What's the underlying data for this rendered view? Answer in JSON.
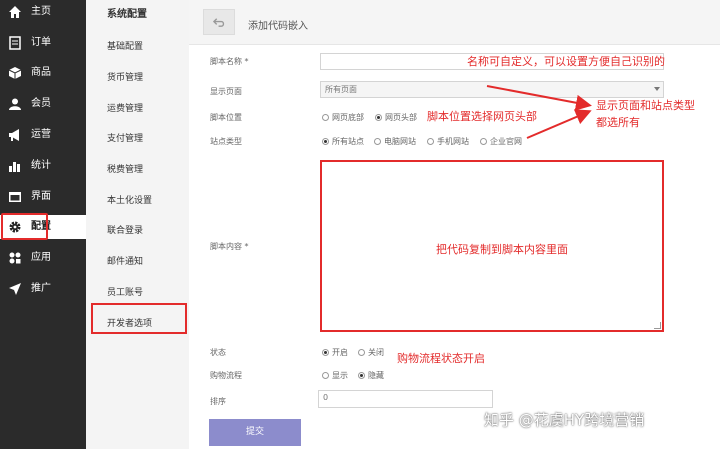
{
  "sidebar": {
    "items": [
      {
        "label": "主页",
        "icon": "home-icon"
      },
      {
        "label": "订单",
        "icon": "order-icon"
      },
      {
        "label": "商品",
        "icon": "box-icon"
      },
      {
        "label": "会员",
        "icon": "user-icon"
      },
      {
        "label": "运营",
        "icon": "megaphone-icon"
      },
      {
        "label": "统计",
        "icon": "bar-chart-icon"
      },
      {
        "label": "界面",
        "icon": "window-icon"
      },
      {
        "label": "配置",
        "icon": "gear-icon"
      },
      {
        "label": "应用",
        "icon": "apps-icon"
      },
      {
        "label": "推广",
        "icon": "send-icon"
      }
    ]
  },
  "subnav": {
    "title": "系统配置",
    "items": [
      "基础配置",
      "货币管理",
      "运费管理",
      "支付管理",
      "税费管理",
      "本土化设置",
      "联合登录",
      "邮件通知",
      "员工账号",
      "开发者选项"
    ]
  },
  "header": {
    "back_icon": "undo-icon",
    "title": "添加代码嵌入"
  },
  "form": {
    "name_label": "脚本名称 *",
    "name_value": "",
    "page_label": "显示页面",
    "page_value": "所有页面",
    "position_label": "脚本位置",
    "position_options": [
      "网页底部",
      "网页头部"
    ],
    "site_label": "站点类型",
    "site_options": [
      "所有站点",
      "电脑网站",
      "手机网站",
      "企业官网"
    ],
    "content_label": "脚本内容 *",
    "status_label": "状态",
    "status_options": [
      "开启",
      "关闭"
    ],
    "flow_label": "购物流程",
    "flow_options": [
      "显示",
      "隐藏"
    ],
    "sort_label": "排序",
    "sort_value": "0",
    "submit_label": "提交"
  },
  "annotations": {
    "name": "名称可自定义，可以设置方便自己识别的",
    "position": "脚本位置选择网页头部",
    "page_site_line1": "显示页面和站点类型",
    "page_site_line2": "都选所有",
    "content": "把代码复制到脚本内容里面",
    "status": "购物流程状态开启"
  },
  "watermark": "知乎 @花虞HY跨境营销",
  "colors": {
    "sidebar_bg": "#2b2b2b",
    "highlight_red": "#e32b2b",
    "submit_bg": "#8c8ccc"
  }
}
